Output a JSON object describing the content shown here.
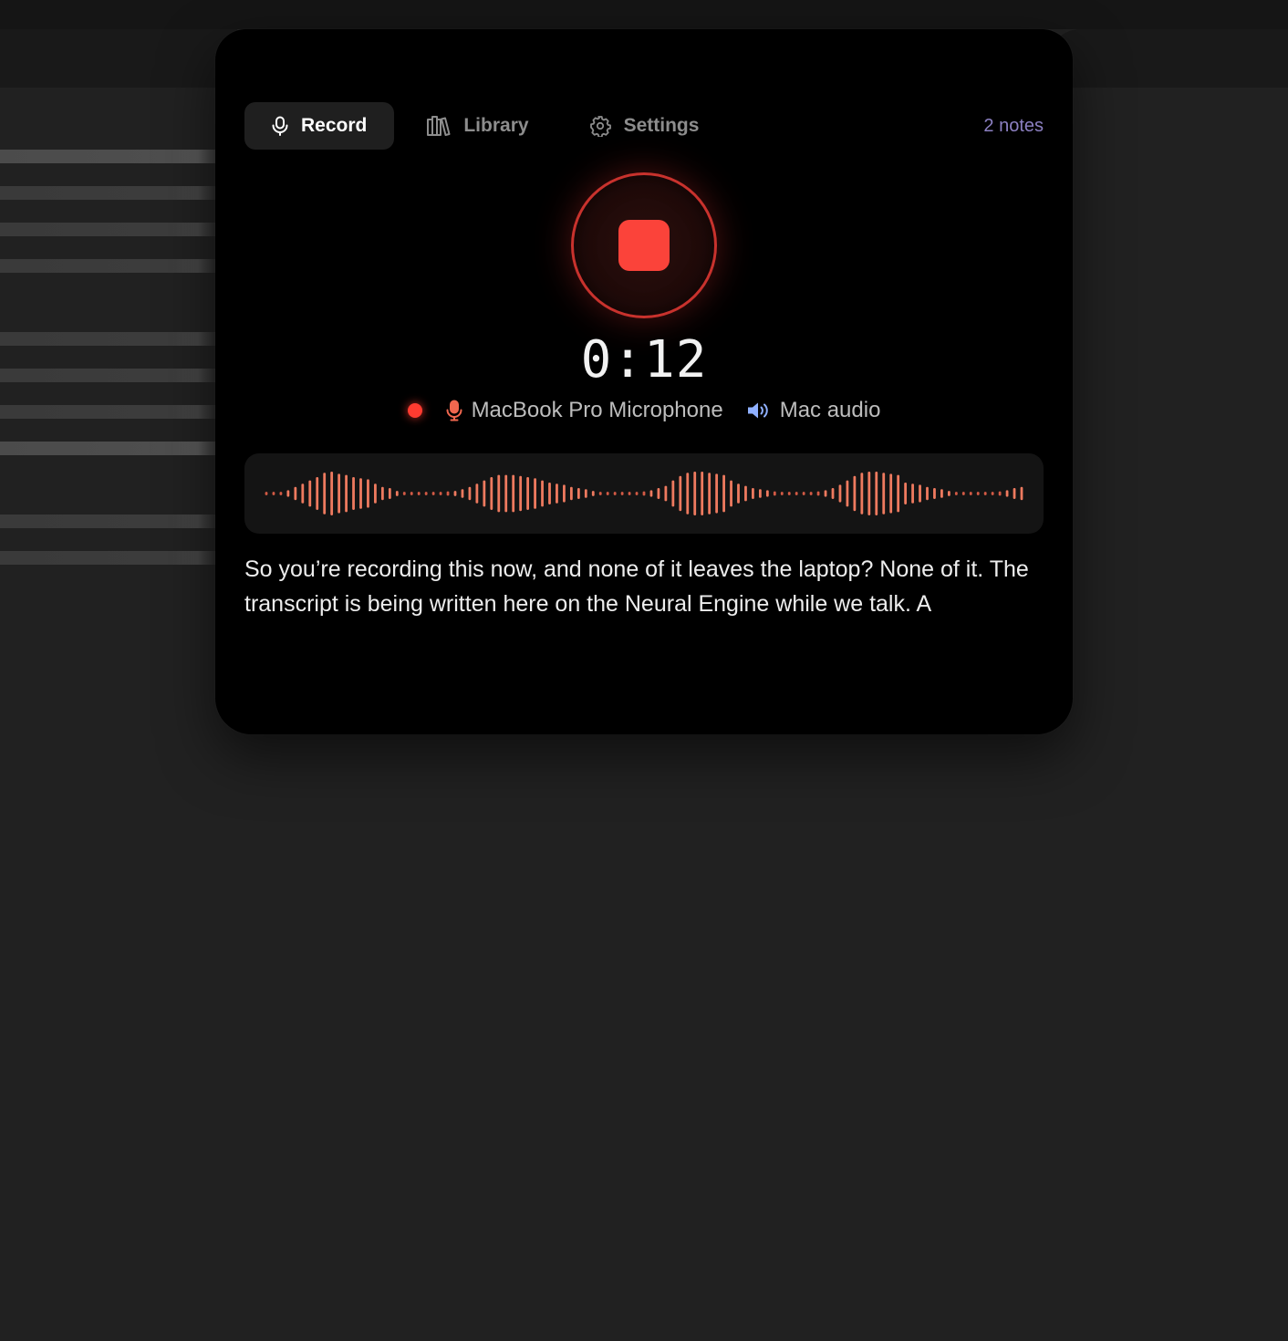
{
  "tabs": [
    {
      "label": "Record",
      "icon": "microphone-icon",
      "active": true
    },
    {
      "label": "Library",
      "icon": "library-icon",
      "active": false
    },
    {
      "label": "Settings",
      "icon": "gear-icon",
      "active": false
    }
  ],
  "notes_count": "2 notes",
  "recording": {
    "elapsed": "0:12",
    "state": "recording",
    "input_source": "MacBook Pro Microphone",
    "output_source": "Mac audio"
  },
  "waveform": {
    "color": "#ee7a5f",
    "levels": [
      0.08,
      0.08,
      0.08,
      0.15,
      0.3,
      0.45,
      0.6,
      0.75,
      0.95,
      1,
      0.9,
      0.85,
      0.75,
      0.7,
      0.65,
      0.45,
      0.3,
      0.25,
      0.12,
      0.08,
      0.08,
      0.08,
      0.08,
      0.08,
      0.08,
      0.1,
      0.12,
      0.2,
      0.3,
      0.45,
      0.6,
      0.75,
      0.85,
      0.85,
      0.85,
      0.8,
      0.75,
      0.7,
      0.6,
      0.5,
      0.45,
      0.4,
      0.3,
      0.25,
      0.2,
      0.12,
      0.08,
      0.08,
      0.08,
      0.08,
      0.08,
      0.08,
      0.1,
      0.15,
      0.25,
      0.35,
      0.6,
      0.8,
      0.95,
      1,
      1,
      0.95,
      0.9,
      0.85,
      0.6,
      0.45,
      0.35,
      0.25,
      0.2,
      0.15,
      0.1,
      0.08,
      0.08,
      0.08,
      0.08,
      0.08,
      0.1,
      0.15,
      0.25,
      0.4,
      0.6,
      0.8,
      0.95,
      1,
      1,
      0.95,
      0.9,
      0.85,
      0.5,
      0.45,
      0.4,
      0.3,
      0.25,
      0.2,
      0.12,
      0.08,
      0.08,
      0.08,
      0.08,
      0.08,
      0.08,
      0.1,
      0.15,
      0.25,
      0.3
    ],
    "silent_color": "#d35a45"
  },
  "transcript": "So you’re recording this now, and none of it leaves the laptop? None of it. The transcript is being written here on the Neural Engine while we talk. A",
  "colors": {
    "accent_red": "#fb433a",
    "notes_purple": "#8c80c2",
    "speaker_blue": "#8fb0ff"
  }
}
